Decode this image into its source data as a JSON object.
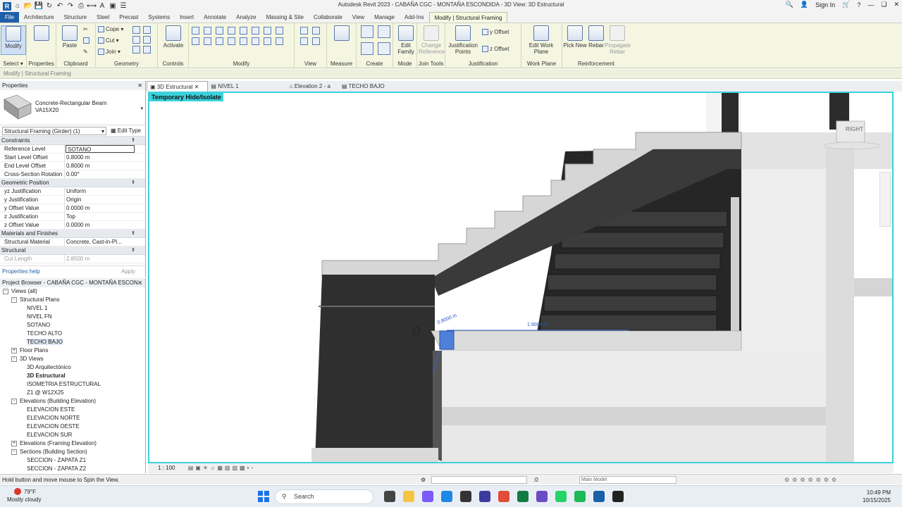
{
  "app": {
    "title": "Autodesk Revit 2023 - CABAÑA CGC - MONTAÑA ESCONDIDA - 3D View: 3D Estructural",
    "sign_in": "Sign In"
  },
  "ribbon_tabs": [
    "File",
    "Architecture",
    "Structure",
    "Steel",
    "Precast",
    "Systems",
    "Insert",
    "Annotate",
    "Analyze",
    "Massing & Site",
    "Collaborate",
    "View",
    "Manage",
    "Add-Ins",
    "Modify | Structural Framing"
  ],
  "ribbon": {
    "modify": "Modify",
    "select": "Select",
    "properties": "Properties",
    "paste": "Paste",
    "clipboard": "Clipboard",
    "cope": "Cope",
    "cut": "Cut",
    "join": "Join",
    "geometry": "Geometry",
    "activate": "Activate",
    "controls": "Controls",
    "modify_group": "Modify",
    "view": "View",
    "measure": "Measure",
    "create": "Create",
    "edit_family": "Edit Family",
    "mode": "Mode",
    "change_reference": "Change Reference",
    "join_tools": "Join Tools",
    "justification_points": "Justification Points",
    "y_offset": "y Offset",
    "z_offset": "z Offset",
    "justification": "Justification",
    "edit_work_plane": "Edit Work Plane",
    "work_plane": "Work Plane",
    "pick_new": "Pick New",
    "rebar": "Rebar",
    "propagate_rebar": "Propagate Rebar",
    "reinforcement": "Reinforcement"
  },
  "options_bar": "Modify | Structural Framing",
  "properties": {
    "header": "Properties",
    "type_line1": "Concrete-Rectangular Beam",
    "type_line2": "VA15X20",
    "filter": "Structural Framing (Girder) (1)",
    "edit_type": "Edit Type",
    "groups": [
      {
        "name": "Constraints",
        "rows": [
          {
            "k": "Reference Level",
            "v": "SOTANO"
          },
          {
            "k": "Start Level Offset",
            "v": "0.8000 m"
          },
          {
            "k": "End Level Offset",
            "v": "0.8000 m"
          },
          {
            "k": "Cross-Section Rotation",
            "v": "0.00°"
          }
        ]
      },
      {
        "name": "Geometric Position",
        "rows": [
          {
            "k": "yz Justification",
            "v": "Uniform"
          },
          {
            "k": "y Justification",
            "v": "Origin"
          },
          {
            "k": "y Offset Value",
            "v": "0.0000 m"
          },
          {
            "k": "z Justification",
            "v": "Top"
          },
          {
            "k": "z Offset Value",
            "v": "0.0000 m"
          }
        ]
      },
      {
        "name": "Materials and Finishes",
        "rows": [
          {
            "k": "Structural Material",
            "v": "Concrete, Cast-in-Pl..."
          }
        ]
      },
      {
        "name": "Structural",
        "rows": [
          {
            "k": "Cut Length",
            "v": "2.8500 m"
          }
        ]
      }
    ],
    "help": "Properties help",
    "apply": "Apply"
  },
  "browser": {
    "header": "Project Browser - CABAÑA CGC - MONTAÑA ESCON...",
    "nodes": [
      {
        "label": "Views (all)",
        "indent": 0,
        "toggle": "-"
      },
      {
        "label": "Structural Plans",
        "indent": 1,
        "toggle": "-"
      },
      {
        "label": "NIVEL 1",
        "indent": 2
      },
      {
        "label": "NIVEL FN",
        "indent": 2
      },
      {
        "label": "SOTANO",
        "indent": 2
      },
      {
        "label": "TECHO ALTO",
        "indent": 2
      },
      {
        "label": "TECHO BAJO",
        "indent": 2,
        "hl": true
      },
      {
        "label": "Floor Plans",
        "indent": 1,
        "toggle": "+"
      },
      {
        "label": "3D Views",
        "indent": 1,
        "toggle": "-"
      },
      {
        "label": "3D Arquitectónico",
        "indent": 2
      },
      {
        "label": "3D Estructural",
        "indent": 2,
        "bold": true
      },
      {
        "label": "ISOMETRIA ESTRUCTURAL",
        "indent": 2
      },
      {
        "label": "Z1 @ W12X25",
        "indent": 2
      },
      {
        "label": "Elevations (Building Elevation)",
        "indent": 1,
        "toggle": "-"
      },
      {
        "label": "ELEVACION ESTE",
        "indent": 2
      },
      {
        "label": "ELEVACION NORTE",
        "indent": 2
      },
      {
        "label": "ELEVACION OESTE",
        "indent": 2
      },
      {
        "label": "ELEVACION SUR",
        "indent": 2
      },
      {
        "label": "Elevations (Framing Elevation)",
        "indent": 1,
        "toggle": "+"
      },
      {
        "label": "Sections (Building Section)",
        "indent": 1,
        "toggle": "-"
      },
      {
        "label": "SECCION - ZAPATA Z1",
        "indent": 2
      },
      {
        "label": "SECCION - ZAPATA Z2",
        "indent": 2
      }
    ]
  },
  "view_tabs": [
    "3D Estructural",
    "NIVEL 1",
    "Elevation 2 - a",
    "TECHO BAJO"
  ],
  "viewport": {
    "temp_hide": "Temporary Hide/Isolate",
    "viewcube": "RIGHT",
    "dim1": "0.8000 m",
    "dim2": "1.9000 m"
  },
  "view_control": {
    "scale": "1 : 100"
  },
  "status": {
    "message": "Hold button and move mouse to Spin the View.",
    "zero": ":0",
    "model": "Main Model"
  },
  "taskbar": {
    "temp": "79°F",
    "weather": "Mostly cloudy",
    "search": "Search",
    "time": "10:49 PM",
    "date": "10/15/2025"
  }
}
